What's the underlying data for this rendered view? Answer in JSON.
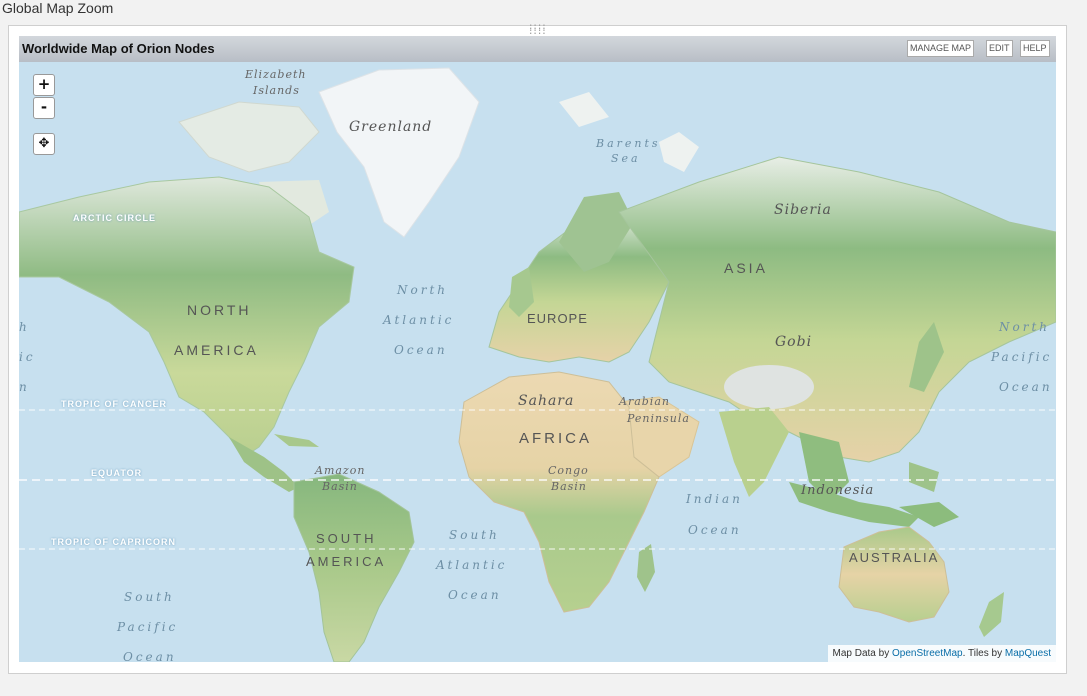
{
  "page": {
    "title": "Global Map Zoom"
  },
  "widget": {
    "title": "Worldwide Map of Orion Nodes",
    "buttons": {
      "manage": "MANAGE MAP",
      "edit": "EDIT",
      "help": "HELP"
    }
  },
  "map_controls": {
    "zoom_in": "+",
    "zoom_out": "-",
    "pan": "✥"
  },
  "labels": {
    "elizabeth1": "Elizabeth",
    "elizabeth2": "Islands",
    "greenland": "Greenland",
    "barents1": "Barents",
    "barents2": "Sea",
    "arctic_circle": "ARCTIC CIRCLE",
    "siberia": "Siberia",
    "asia": "ASIA",
    "north_america1": "NORTH",
    "north_america2": "AMERICA",
    "europe": "EUROPE",
    "gobi": "Gobi",
    "n_atlantic1": "North",
    "n_atlantic2": "Atlantic",
    "n_atlantic3": "Ocean",
    "n_pacific1": "North",
    "n_pacific2": "Pacific",
    "n_pacific3": "Ocean",
    "w_edge1": "h",
    "w_edge2": "ic",
    "w_edge3": "n",
    "tropic_cancer": "TROPIC OF CANCER",
    "sahara": "Sahara",
    "arabian1": "Arabian",
    "arabian2": "Peninsula",
    "africa": "AFRICA",
    "equator": "EQUATOR",
    "amazon1": "Amazon",
    "amazon2": "Basin",
    "congo1": "Congo",
    "congo2": "Basin",
    "indian1": "Indian",
    "indian2": "Ocean",
    "indonesia": "Indonesia",
    "tropic_capricorn": "TROPIC OF CAPRICORN",
    "south_america1": "SOUTH",
    "south_america2": "AMERICA",
    "s_atlantic1": "South",
    "s_atlantic2": "Atlantic",
    "s_atlantic3": "Ocean",
    "australia": "AUSTRALIA",
    "s_pacific1": "South",
    "s_pacific2": "Pacific",
    "s_pacific3": "Ocean"
  },
  "attribution": {
    "prefix": "Map Data by",
    "osm": "OpenStreetMap",
    "middle": ". Tiles by",
    "mapquest": "MapQuest"
  },
  "colors": {
    "ocean": "#c7e0ef",
    "forest": "#7fb07a",
    "grass": "#bcd48d",
    "desert": "#e9d8b0",
    "ice": "#f2f5f7"
  }
}
